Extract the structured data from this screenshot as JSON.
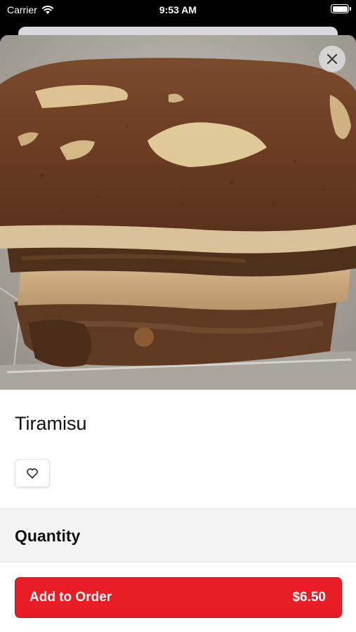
{
  "status_bar": {
    "carrier": "Carrier",
    "time": "9:53 AM"
  },
  "item": {
    "name": "Tiramisu",
    "image_subject": "tiramisu slice in plastic container"
  },
  "sections": {
    "quantity_heading": "Quantity"
  },
  "footer": {
    "add_label": "Add to Order",
    "price": "$6.50"
  },
  "colors": {
    "accent": "#E81C25",
    "sheet_bg": "#FFFFFF",
    "options_bg": "#F4F4F4"
  },
  "icons": [
    "wifi-icon",
    "battery-icon",
    "close-icon",
    "heart-icon"
  ]
}
